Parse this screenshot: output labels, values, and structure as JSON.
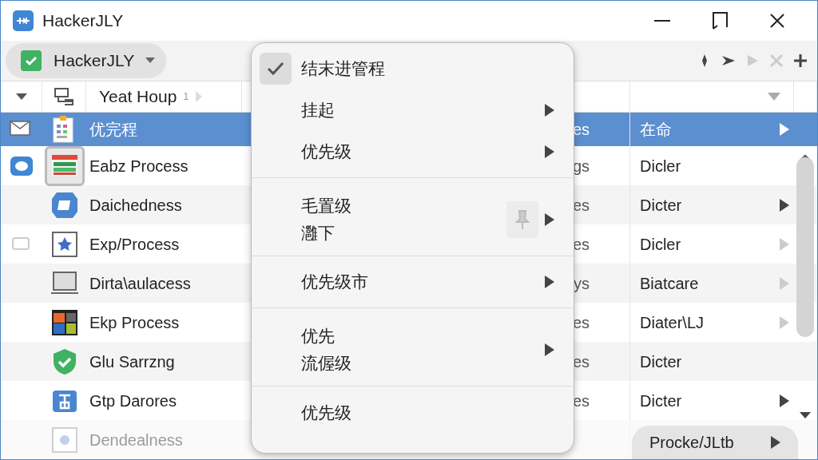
{
  "window": {
    "title": "HackerJLY"
  },
  "toolbar": {
    "profile": "HackerJLY"
  },
  "header": {
    "column_name": "Yeat Houp",
    "column_name_mark": "1"
  },
  "rows": [
    {
      "name": "优完程",
      "column_3": "es",
      "status": "在命",
      "selected": true,
      "submenu": true,
      "dimmed": true,
      "framed": false
    },
    {
      "name": "Eabz Process",
      "column_3": "gs",
      "status": "Dicler",
      "selected": false,
      "submenu": false,
      "framed": true
    },
    {
      "name": "Daichedness",
      "column_3": "es",
      "status": "Dicter",
      "selected": false,
      "submenu": true,
      "dimmed": false,
      "framed": false
    },
    {
      "name": "Exp/Process",
      "column_3": "es",
      "status": "Dicler",
      "selected": false,
      "submenu": true,
      "dimmed": true,
      "framed": false
    },
    {
      "name": "Dirta\\aulacess",
      "column_3": "ys",
      "status": "Biatcare",
      "selected": false,
      "submenu": true,
      "dimmed": true,
      "framed": false
    },
    {
      "name": "Ekp Process",
      "column_3": "es",
      "status": "Diater\\LJ",
      "selected": false,
      "submenu": true,
      "dimmed": true,
      "framed": false
    },
    {
      "name": "Glu Sarrzng",
      "column_3": "es",
      "status": "Dicter",
      "selected": false,
      "submenu": false,
      "framed": false
    },
    {
      "name": "Gtp Darores",
      "column_3": "es",
      "status": "Dicter",
      "selected": false,
      "submenu": true,
      "dimmed": false,
      "framed": false
    },
    {
      "name": "Dendealness",
      "selected": false,
      "framed": false
    }
  ],
  "context_menu": {
    "items": [
      {
        "lines": [
          "结末进管程"
        ],
        "checked": true,
        "submenu": false,
        "separator_before": false
      },
      {
        "lines": [
          "挂起"
        ],
        "checked": false,
        "submenu": true,
        "separator_before": false
      },
      {
        "lines": [
          "优先级"
        ],
        "checked": false,
        "submenu": true,
        "separator_before": false
      },
      {
        "lines": [
          "毛置级",
          "灉下"
        ],
        "checked": false,
        "submenu": true,
        "separator_before": true,
        "pin": true
      },
      {
        "lines": [
          "优先级市"
        ],
        "checked": false,
        "submenu": true,
        "separator_before": true
      },
      {
        "lines": [
          "优先",
          "流偓级"
        ],
        "checked": false,
        "submenu": true,
        "separator_before": true
      },
      {
        "lines": [
          "优先级"
        ],
        "checked": false,
        "submenu": false,
        "separator_before": true
      }
    ]
  },
  "footer_button": {
    "label": "Procke/JLtb"
  }
}
